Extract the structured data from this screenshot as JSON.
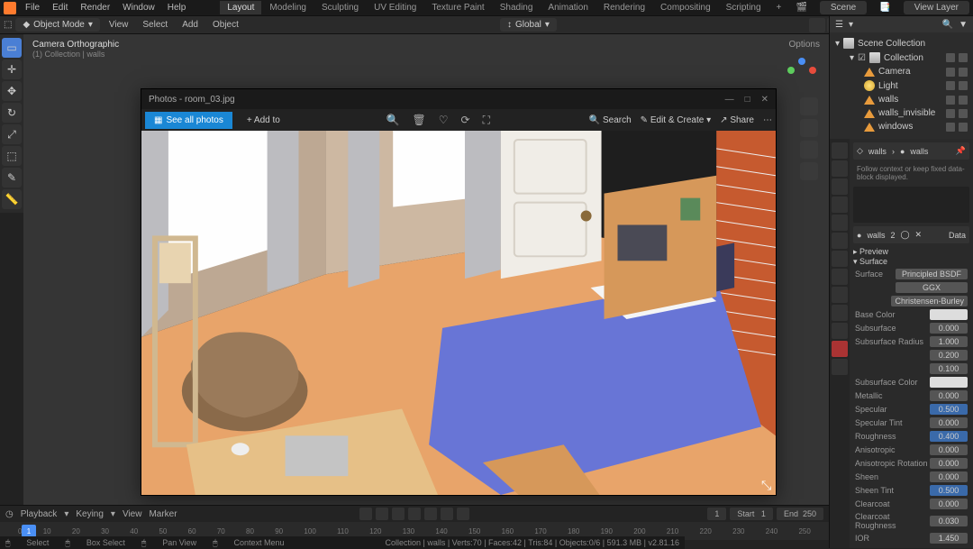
{
  "top_menu": {
    "items": [
      "File",
      "Edit",
      "Render",
      "Window",
      "Help"
    ],
    "workspace_tabs": [
      "Layout",
      "Modeling",
      "Sculpting",
      "UV Editing",
      "Texture Paint",
      "Shading",
      "Animation",
      "Rendering",
      "Compositing",
      "Scripting"
    ],
    "active_tab": "Layout",
    "scene_label": "Scene",
    "view_layer_label": "View Layer"
  },
  "secondary_bar": {
    "mode": "Object Mode",
    "menus": [
      "View",
      "Select",
      "Add",
      "Object"
    ],
    "transform_orientation": "Global"
  },
  "viewport": {
    "camera_label": "Camera Orthographic",
    "collection_label": "(1) Collection | walls",
    "options_label": "Options"
  },
  "photos_window": {
    "title": "Photos - room_03.jpg",
    "see_all": "See all photos",
    "add_to": "+ Add to",
    "search": "Search",
    "edit": "Edit & Create",
    "share": "Share"
  },
  "outliner": {
    "root": "Scene Collection",
    "items": [
      {
        "name": "Collection",
        "type": "collection"
      },
      {
        "name": "Camera",
        "type": "cam"
      },
      {
        "name": "Light",
        "type": "light"
      },
      {
        "name": "walls",
        "type": "mesh"
      },
      {
        "name": "walls_invisible",
        "type": "mesh"
      },
      {
        "name": "windows",
        "type": "mesh"
      }
    ]
  },
  "properties": {
    "breadcrumb1": "walls",
    "breadcrumb2": "walls",
    "pin_msg": "Follow context or keep fixed data-block displayed.",
    "material_name": "walls",
    "data_btn": "Data",
    "preview": "Preview",
    "surface_section": "Surface",
    "surface_label": "Surface",
    "surface_value": "Principled BSDF",
    "distribution_value": "GGX",
    "sss_method_value": "Christensen-Burley",
    "rows": [
      {
        "label": "Base Color",
        "type": "swatch"
      },
      {
        "label": "Subsurface",
        "value": "0.000"
      },
      {
        "label": "Subsurface Radius",
        "value": "1.000"
      },
      {
        "label": "",
        "value": "0.200"
      },
      {
        "label": "",
        "value": "0.100"
      },
      {
        "label": "Subsurface Color",
        "type": "swatch"
      },
      {
        "label": "Metallic",
        "value": "0.000"
      },
      {
        "label": "Specular",
        "value": "0.500",
        "blue": true
      },
      {
        "label": "Specular Tint",
        "value": "0.000"
      },
      {
        "label": "Roughness",
        "value": "0.400",
        "blue": true
      },
      {
        "label": "Anisotropic",
        "value": "0.000"
      },
      {
        "label": "Anisotropic Rotation",
        "value": "0.000"
      },
      {
        "label": "Sheen",
        "value": "0.000"
      },
      {
        "label": "Sheen Tint",
        "value": "0.500",
        "blue": true
      },
      {
        "label": "Clearcoat",
        "value": "0.000"
      },
      {
        "label": "Clearcoat Roughness",
        "value": "0.030"
      },
      {
        "label": "IOR",
        "value": "1.450"
      }
    ]
  },
  "timeline": {
    "menus": [
      "Playback",
      "Keying",
      "View",
      "Marker"
    ],
    "current_frame": "1",
    "start_label": "Start",
    "start": "1",
    "end_label": "End",
    "end": "250",
    "ticks": [
      "0",
      "10",
      "20",
      "30",
      "40",
      "50",
      "60",
      "70",
      "80",
      "90",
      "100",
      "110",
      "120",
      "130",
      "140",
      "150",
      "160",
      "170",
      "180",
      "190",
      "200",
      "210",
      "220",
      "230",
      "240",
      "250"
    ]
  },
  "status_bar": {
    "select": "Select",
    "box_select": "Box Select",
    "pan_view": "Pan View",
    "context_menu": "Context Menu",
    "stats": "Collection | walls | Verts:70 | Faces:42 | Tris:84 | Objects:0/6 | 591.3 MB | v2.81.16"
  }
}
